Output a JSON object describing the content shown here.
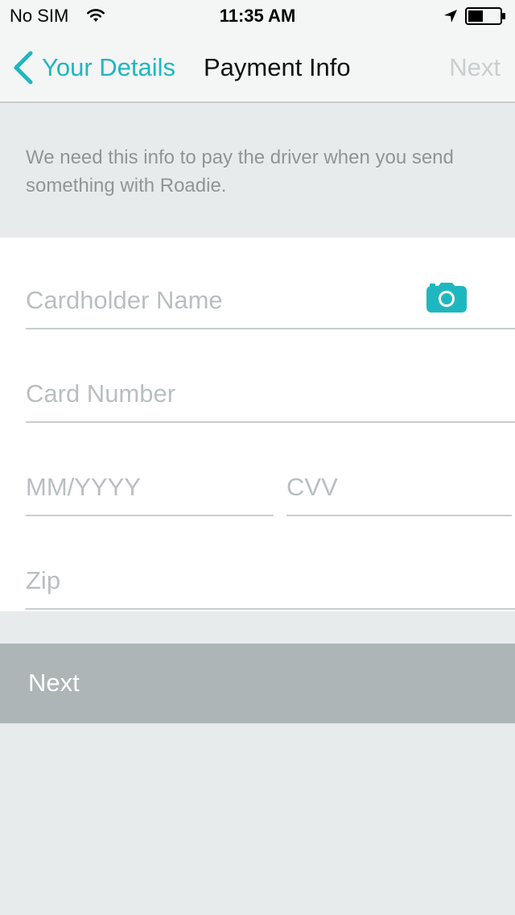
{
  "status_bar": {
    "carrier": "No SIM",
    "time": "11:35 AM"
  },
  "nav": {
    "back_label": "Your Details",
    "title": "Payment Info",
    "next_label": "Next"
  },
  "info": {
    "text": "We need this info to pay the driver when you send something with Roadie."
  },
  "form": {
    "cardholder_placeholder": "Cardholder Name",
    "card_number_placeholder": "Card Number",
    "expiry_placeholder": "MM/YYYY",
    "cvv_placeholder": "CVV",
    "zip_placeholder": "Zip"
  },
  "next_button": {
    "label": "Next"
  },
  "colors": {
    "accent": "#1fb7bf",
    "next_button_bg": "#adb5b6",
    "background": "#e8ebec"
  },
  "icons": [
    "wifi-icon",
    "location-arrow-icon",
    "battery-icon",
    "chevron-left-icon",
    "camera-icon"
  ]
}
